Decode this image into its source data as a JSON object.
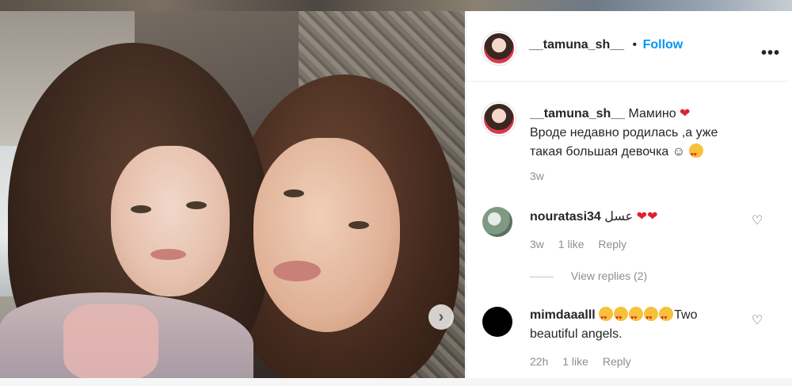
{
  "post": {
    "author": "__tamuna_sh__",
    "follow_label": "Follow",
    "separator": "•",
    "more_icon": "more-horizontal-icon"
  },
  "caption": {
    "username": "__tamuna_sh__",
    "text_line1": "Мамино",
    "text_line2": "Вроде недавно родилась ,а уже",
    "text_line3": "такая большая девочка ☺",
    "time": "3w"
  },
  "comments": [
    {
      "username": "nouratasi34",
      "text": "عسل",
      "time": "3w",
      "likes": "1 like",
      "reply_label": "Reply",
      "view_replies": "View replies (2)"
    },
    {
      "username": "mimdaaalll",
      "text_line1": "Two",
      "text_line2": "beautiful angels.",
      "time": "22h",
      "likes": "1 like",
      "reply_label": "Reply"
    }
  ],
  "colors": {
    "accent": "#0095f6",
    "heart": "#e0202d",
    "muted": "#8e8e8e"
  },
  "icons": {
    "next": "chevron-right-icon",
    "heart": "heart-outline-icon"
  }
}
